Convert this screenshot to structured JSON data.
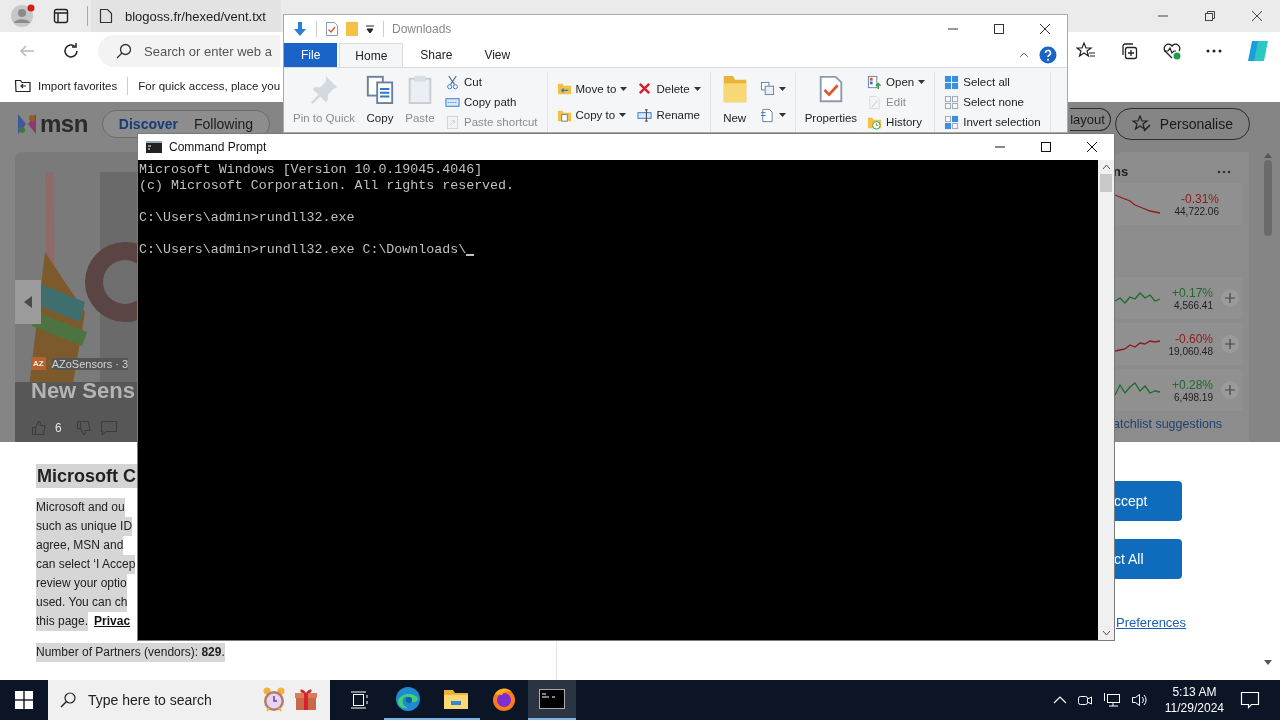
{
  "browser": {
    "tab": "blogoss.fr/hexed/vent.txt",
    "address": {
      "placeholder": "Search or enter web a"
    },
    "favorites": [
      "Import favorites",
      "For quick access, place you"
    ]
  },
  "msn": {
    "logo": "msn",
    "nav": [
      {
        "label": "Discover",
        "selected": true
      },
      {
        "label": "Following",
        "selected": false
      }
    ],
    "actions": [
      "layout",
      "Personalise"
    ],
    "story": {
      "source_logo": "AZ",
      "source": "AZoSensors · 3",
      "headline": "New Sens",
      "likes": "6"
    },
    "markets": {
      "title": "ns",
      "rows": [
        {
          "change": "-0.31%",
          "value": "44,722.06",
          "color": "#8e1b1b",
          "addable": false
        },
        {
          "change": "+0.17%",
          "value": "4,566.41",
          "color": "#1d6b2a",
          "addable": true
        },
        {
          "change": "-0.60%",
          "value": "19,060.48",
          "color": "#8e1b1b",
          "addable": true
        },
        {
          "change": "+0.28%",
          "value": "6,498.19",
          "color": "#1d6b2a",
          "addable": true
        }
      ],
      "footer": "atchlist suggestions"
    }
  },
  "consent": {
    "heading": "Microsoft C",
    "lines": [
      "Microsoft and ou",
      "such as unique ID",
      "agree, MSN and",
      "can select ‘I Accep",
      "review your optio",
      "used. You can ch"
    ],
    "last_line": "this page.",
    "privacy_link": "Privac",
    "partners": "Number of Partners (vendors): **829**.",
    "buttons": [
      "ccept",
      "ct All"
    ],
    "preferences_link": "Preferences"
  },
  "explorer": {
    "title": "Downloads",
    "tabs": [
      {
        "label": "File",
        "kind": "file",
        "selected": false
      },
      {
        "label": "Home",
        "kind": "tab",
        "selected": true
      },
      {
        "label": "Share",
        "kind": "tab",
        "selected": false
      },
      {
        "label": "View",
        "kind": "tab",
        "selected": false
      }
    ],
    "groups": [
      {
        "items": [
          {
            "kind": "large",
            "label": "Pin to Quick",
            "disabled": true
          },
          {
            "kind": "large",
            "label": "Copy",
            "disabled": false
          },
          {
            "kind": "large",
            "label": "Paste",
            "disabled": true
          },
          {
            "kind": "stack",
            "items": [
              {
                "label": "Cut",
                "disabled": false,
                "menu": false
              },
              {
                "label": "Copy path",
                "disabled": false,
                "menu": false
              },
              {
                "label": "Paste shortcut",
                "disabled": true,
                "menu": false
              }
            ]
          }
        ]
      },
      {
        "items": [
          {
            "kind": "stack",
            "items": [
              {
                "label": "Move to",
                "disabled": false,
                "menu": true
              },
              {
                "label": "Copy to",
                "disabled": false,
                "menu": true
              }
            ]
          },
          {
            "kind": "stack",
            "items": [
              {
                "label": "Delete",
                "disabled": false,
                "menu": true
              },
              {
                "label": "Rename",
                "disabled": false,
                "menu": false
              }
            ]
          }
        ]
      },
      {
        "items": [
          {
            "kind": "large",
            "label": "New",
            "disabled": false
          },
          {
            "kind": "stack",
            "items": [
              {
                "disabled": false,
                "menu": true
              },
              {
                "disabled": false,
                "menu": true
              }
            ]
          }
        ]
      },
      {
        "items": [
          {
            "kind": "large",
            "label": "Properties",
            "disabled": false
          },
          {
            "kind": "stack",
            "items": [
              {
                "label": "Open",
                "disabled": false,
                "menu": true
              },
              {
                "label": "Edit",
                "disabled": true,
                "menu": false
              },
              {
                "label": "History",
                "disabled": false,
                "menu": false
              }
            ]
          }
        ]
      },
      {
        "items": [
          {
            "kind": "stack",
            "items": [
              {
                "label": "Select all",
                "disabled": false,
                "menu": false
              },
              {
                "label": "Select none",
                "disabled": false,
                "menu": false
              },
              {
                "label": "Invert selection",
                "disabled": false,
                "menu": false
              }
            ]
          }
        ]
      }
    ]
  },
  "cmd": {
    "title": "Command Prompt",
    "blocks": [
      [
        "Microsoft Windows [Version 10.0.19045.4046]",
        "(c) Microsoft Corporation. All rights reserved."
      ],
      [
        "C:\\Users\\admin>rundll32.exe"
      ],
      [
        "C:\\Users\\admin>rundll32.exe C:\\Downloads\\"
      ]
    ],
    "cursor": true
  },
  "taskbar": {
    "search": {
      "placeholder": "Type here to search"
    },
    "apps": [
      {
        "kind": "edge",
        "running": true,
        "selected": false
      },
      {
        "kind": "explorer",
        "running": true,
        "selected": false
      },
      {
        "kind": "firefox",
        "running": false,
        "selected": false
      },
      {
        "kind": "terminal",
        "running": true,
        "selected": true
      }
    ],
    "time": "5:13 AM",
    "date": "11/29/2024"
  }
}
